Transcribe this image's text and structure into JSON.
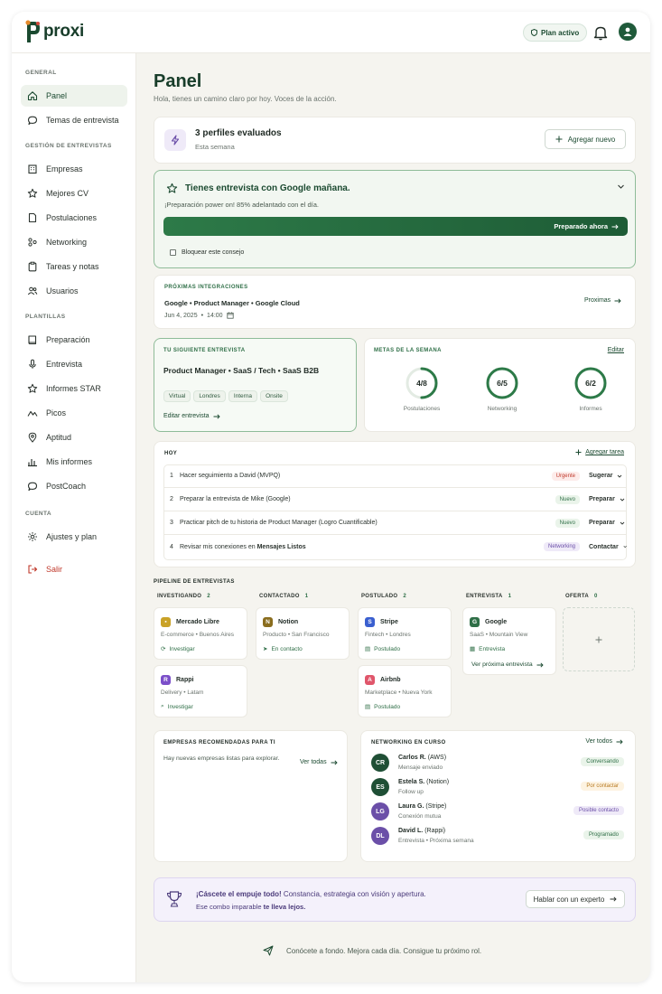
{
  "app": {
    "name": "proxi",
    "plan_label": "Plan activo"
  },
  "sidebar": {
    "sections": [
      {
        "title": "GENERAL",
        "items": [
          {
            "label": "Panel",
            "icon": "home-icon",
            "active": true
          },
          {
            "label": "Temas de entrevista",
            "icon": "chat-icon"
          }
        ]
      },
      {
        "title": "GESTIÓN DE ENTREVISTAS",
        "items": [
          {
            "label": "Empresas",
            "icon": "building-icon"
          },
          {
            "label": "Mejores CV",
            "icon": "star-icon"
          },
          {
            "label": "Postulaciones",
            "icon": "document-icon"
          },
          {
            "label": "Networking",
            "icon": "network-icon"
          },
          {
            "label": "Tareas y notas",
            "icon": "clipboard-icon"
          },
          {
            "label": "Usuarios",
            "icon": "users-icon"
          }
        ]
      },
      {
        "title": "PLANTILLAS",
        "items": [
          {
            "label": "Preparación",
            "icon": "book-icon"
          },
          {
            "label": "Entrevista",
            "icon": "microphone-icon"
          },
          {
            "label": "Informes STAR",
            "icon": "star-icon"
          },
          {
            "label": "Picos",
            "icon": "peaks-icon"
          },
          {
            "label": "Aptitud",
            "icon": "pin-icon"
          },
          {
            "label": "Mis informes",
            "icon": "chart-icon"
          },
          {
            "label": "PostCoach",
            "icon": "bubble-icon"
          }
        ]
      },
      {
        "title": "CUENTA",
        "items": [
          {
            "label": "Ajustes y plan",
            "icon": "gear-icon"
          }
        ]
      }
    ],
    "logout_label": "Salir"
  },
  "header": {
    "title": "Panel",
    "subtitle": "Hola, tienes un camino claro por hoy. Voces de la acción."
  },
  "profiles": {
    "title": "3 perfiles evaluados",
    "subtitle": "Esta semana",
    "add_label": "Agregar nuevo"
  },
  "alert": {
    "title": "Tienes entrevista con Google mañana.",
    "text": "¡Preparación power on! 85% adelantado con el día.",
    "progress_percent": 100,
    "button_label": "Preparado ahora",
    "checkbox_label": "Bloquear este consejo"
  },
  "integrations": {
    "caption": "PRÓXIMAS INTEGRACIONES",
    "parts": [
      "Google",
      "Product Manager",
      "Google Cloud"
    ],
    "date": "Jun 4, 2025",
    "time": "14:00",
    "link_label": "Proximas"
  },
  "next_interview": {
    "caption": "TU SIGUIENTE ENTREVISTA",
    "parts": [
      "Product Manager",
      "SaaS / Tech",
      "SaaS B2B"
    ],
    "tags": [
      "Virtual",
      "Londres",
      "Interna",
      "Onsite"
    ],
    "edit_label": "Editar entrevista"
  },
  "weekly_goals": {
    "caption": "METAS DE LA SEMANA",
    "edit_label": "Editar",
    "goals": [
      {
        "label": "Postulaciones",
        "value": "4/8",
        "fraction": 0.5
      },
      {
        "label": "Networking",
        "value": "6/5",
        "fraction": 1
      },
      {
        "label": "Informes",
        "value": "6/2",
        "fraction": 1
      }
    ]
  },
  "today": {
    "caption": "HOY",
    "add_label": "Agregar tarea",
    "tasks": [
      {
        "num": "1",
        "text": "Hacer seguimiento a David (MVPQ)",
        "badge": "Urgente",
        "kind": "urgent",
        "action": "Sugerar"
      },
      {
        "num": "2",
        "text": "Preparar la entrevista de Mike (Google)",
        "badge": "Nuevo",
        "kind": "new",
        "action": "Preparar"
      },
      {
        "num": "3",
        "text": "Practicar pitch de tu historia de Product Manager (Logro Cuantificable)",
        "badge": "Nuevo",
        "kind": "new",
        "action": "Preparar"
      },
      {
        "num": "4",
        "text_plain": "Revisar mis conexiones en ",
        "text_bold": "Mensajes Listos",
        "badge": "Networking",
        "kind": "net",
        "action": "Contactar"
      }
    ]
  },
  "pipeline": {
    "caption": "PIPELINE DE ENTREVISTAS",
    "columns": [
      {
        "title": "INVESTIGANDO",
        "count": "2"
      },
      {
        "title": "CONTACTADO",
        "count": "1"
      },
      {
        "title": "POSTULADO",
        "count": "2"
      },
      {
        "title": "ENTREVISTA",
        "count": "1"
      },
      {
        "title": "OFERTA",
        "count": "0"
      }
    ],
    "cards": {
      "mercado": {
        "name": "Mercado Libre",
        "meta": "E-commerce • Buenos Aires",
        "status": "Investigar",
        "color": "#c9a227"
      },
      "notion": {
        "name": "Notion",
        "meta": "Producto • San Francisco",
        "status": "En contacto",
        "color": "#8a6d1e"
      },
      "stripe": {
        "name": "Stripe",
        "meta": "Fintech • Londres",
        "status": "Postulado",
        "color": "#3a5fcf"
      },
      "google": {
        "name": "Google",
        "meta": "SaaS • Mountain View",
        "status": "Entrevista",
        "link": "Ver próxima entrevista",
        "color": "#2f6f47"
      },
      "rappi": {
        "name": "Rappi",
        "meta": "Delivery • Latam",
        "status": "Investigar",
        "color": "#7b4fc9"
      },
      "airbnb": {
        "name": "Airbnb",
        "meta": "Marketplace • Nueva York",
        "status": "Postulado",
        "color": "#e0566b"
      }
    }
  },
  "recommended": {
    "caption": "EMPRESAS RECOMENDADAS PARA TI",
    "text": "Hay nuevas empresas listas para explorar.",
    "link_label": "Ver todas"
  },
  "networking": {
    "caption": "NETWORKING EN CURSO",
    "link_label": "Ver todos",
    "people": [
      {
        "initials": "CR",
        "name": "Carlos R.",
        "org": "(AWS)",
        "sub": "Mensaje enviado",
        "badge": "Conversando",
        "color": "#1f4f35"
      },
      {
        "initials": "ES",
        "name": "Estela S.",
        "org": "(Notion)",
        "sub": "Follow up",
        "badge": "Por contactar",
        "color": "#1f4f35"
      },
      {
        "initials": "LG",
        "name": "Laura G.",
        "org": "(Stripe)",
        "sub": "Conexión mutua",
        "badge": "Posible contacto",
        "color": "#6b4fa8"
      },
      {
        "initials": "DL",
        "name": "David L.",
        "org": "(Rappi)",
        "sub": "Entrevista • Próxima semana",
        "badge": "Programado",
        "color": "#6b4fa8"
      }
    ]
  },
  "motivation": {
    "bold": "¡Cáscete el empuje todo!",
    "text": " Constancia, estrategia con visión y apertura.",
    "line2_a": "Ese combo imparable ",
    "line2_b": "te lleva lejos.",
    "button_label": "Hablar con un experto"
  },
  "footer": {
    "text": "Conócete a fondo. Mejora cada día. Consigue tu próximo rol."
  }
}
